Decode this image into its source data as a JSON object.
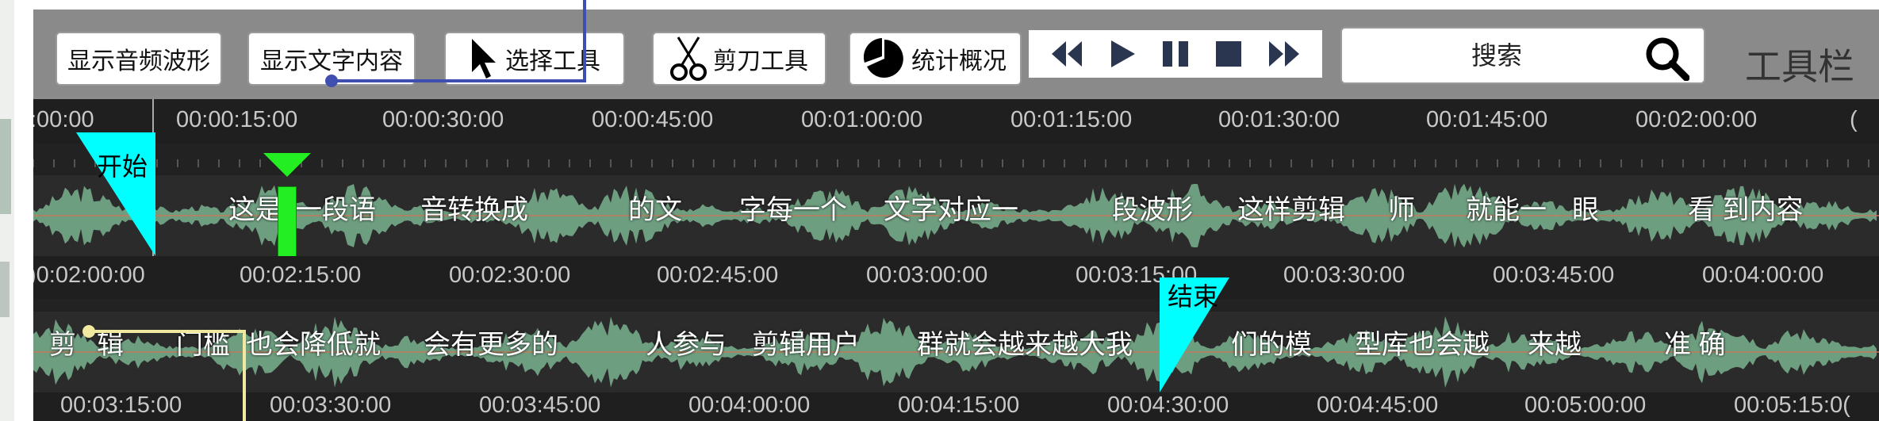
{
  "toolbar": {
    "show_waveform": "显示音频波形",
    "show_text": "显示文字内容",
    "select_tool": "选择工具",
    "cut_tool": "剪刀工具",
    "stats": "统计概况",
    "search_label": "搜索",
    "title": "工具栏"
  },
  "media": {
    "icons": [
      "rewind-icon",
      "play-icon",
      "pause-icon",
      "stop-icon",
      "fast-forward-icon"
    ]
  },
  "track1": {
    "ticks": [
      ":00:00",
      "00:00:15:00",
      "00:00:30:00",
      "00:00:45:00",
      "00:01:00:00",
      "00:01:15:00",
      "00:01:30:00",
      "00:01:45:00",
      "00:02:00:00",
      "("
    ],
    "words": [
      "这是",
      "一段语",
      "音转换成",
      "的文",
      "字每一个",
      "文字对应一",
      "段波形",
      "这样剪辑",
      "师",
      "就能一",
      "眼",
      "看 到内容"
    ],
    "start_marker": "开始"
  },
  "track2": {
    "ticks": [
      ")0:02:00:00",
      "00:02:15:00",
      "00:02:30:00",
      "00:02:45:00",
      "00:03:00:00",
      "00:03:15:00",
      "00:03:30:00",
      "00:03:45:00",
      "00:04:00:00"
    ],
    "words": [
      "剪",
      "辑",
      "门槛",
      "也会降低就",
      "会有更多的",
      "人参与",
      "剪辑用户",
      "群就会越来越大我",
      "们的模",
      "型库也会越",
      "来越",
      "准 确"
    ],
    "end_marker": "结束"
  },
  "track3": {
    "ticks": [
      "00:03:15:00",
      "00:03:30:00",
      "00:03:45:00",
      "00:04:00:00",
      "00:04:15:00",
      "00:04:30:00",
      "00:04:45:00",
      "00:05:00:00",
      "00:05:15:0("
    ]
  },
  "colors": {
    "marker": "#00ffff",
    "playhead": "#22ee22",
    "wave": "#6e9e80",
    "connector_blue": "#3f4fb0",
    "connector_yellow": "#f2e9a0"
  }
}
